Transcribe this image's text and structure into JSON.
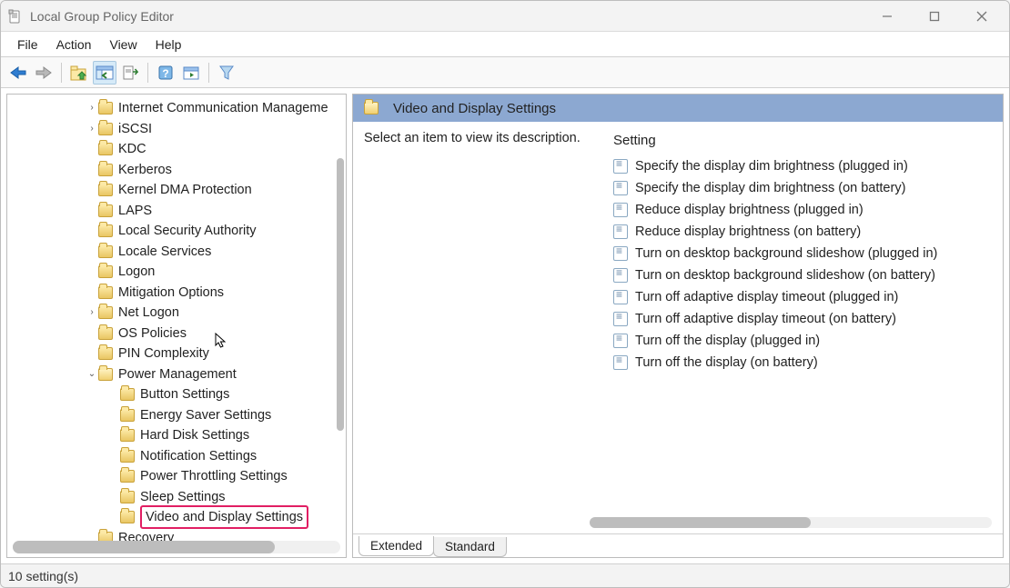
{
  "window": {
    "title": "Local Group Policy Editor"
  },
  "menubar": [
    "File",
    "Action",
    "View",
    "Help"
  ],
  "tree": [
    {
      "indent": 86,
      "expander": "›",
      "label": "Internet Communication Manageme"
    },
    {
      "indent": 86,
      "expander": "›",
      "label": "iSCSI"
    },
    {
      "indent": 86,
      "expander": "",
      "label": "KDC"
    },
    {
      "indent": 86,
      "expander": "",
      "label": "Kerberos"
    },
    {
      "indent": 86,
      "expander": "",
      "label": "Kernel DMA Protection"
    },
    {
      "indent": 86,
      "expander": "",
      "label": "LAPS"
    },
    {
      "indent": 86,
      "expander": "",
      "label": "Local Security Authority"
    },
    {
      "indent": 86,
      "expander": "",
      "label": "Locale Services"
    },
    {
      "indent": 86,
      "expander": "",
      "label": "Logon"
    },
    {
      "indent": 86,
      "expander": "",
      "label": "Mitigation Options"
    },
    {
      "indent": 86,
      "expander": "›",
      "label": "Net Logon"
    },
    {
      "indent": 86,
      "expander": "",
      "label": "OS Policies"
    },
    {
      "indent": 86,
      "expander": "",
      "label": "PIN Complexity"
    },
    {
      "indent": 86,
      "expander": "⌄",
      "label": "Power Management",
      "open": true
    },
    {
      "indent": 110,
      "expander": "",
      "label": "Button Settings"
    },
    {
      "indent": 110,
      "expander": "",
      "label": "Energy Saver Settings"
    },
    {
      "indent": 110,
      "expander": "",
      "label": "Hard Disk Settings"
    },
    {
      "indent": 110,
      "expander": "",
      "label": "Notification Settings"
    },
    {
      "indent": 110,
      "expander": "",
      "label": "Power Throttling Settings"
    },
    {
      "indent": 110,
      "expander": "",
      "label": "Sleep Settings"
    },
    {
      "indent": 110,
      "expander": "",
      "label": "Video and Display Settings",
      "selected": true
    },
    {
      "indent": 86,
      "expander": "",
      "label": "Recovery"
    }
  ],
  "right": {
    "header": "Video and Display Settings",
    "description": "Select an item to view its description.",
    "column_header": "Setting",
    "settings": [
      "Specify the display dim brightness (plugged in)",
      "Specify the display dim brightness (on battery)",
      "Reduce display brightness (plugged in)",
      "Reduce display brightness (on battery)",
      "Turn on desktop background slideshow (plugged in)",
      "Turn on desktop background slideshow (on battery)",
      "Turn off adaptive display timeout (plugged in)",
      "Turn off adaptive display timeout (on battery)",
      "Turn off the display (plugged in)",
      "Turn off the display (on battery)"
    ]
  },
  "tabs": {
    "extended": "Extended",
    "standard": "Standard",
    "active": "extended"
  },
  "status": "10 setting(s)"
}
